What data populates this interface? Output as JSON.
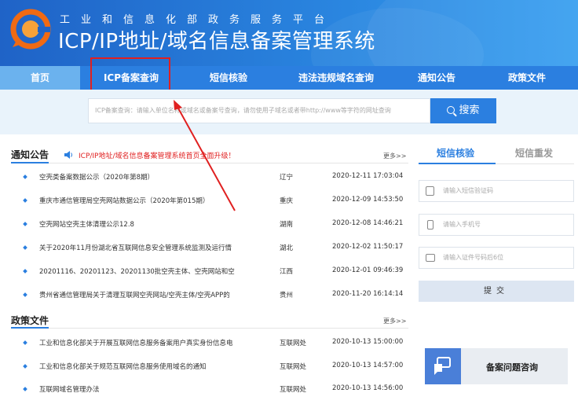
{
  "header": {
    "subtitle": "工业和信息化部政务服务平台",
    "title": "ICP/IP地址/域名信息备案管理系统"
  },
  "nav": {
    "items": [
      "首页",
      "ICP备案查询",
      "短信核验",
      "违法违规域名查询",
      "通知公告",
      "政策文件"
    ],
    "active": "首页",
    "highlighted": "ICP备案查询"
  },
  "search": {
    "placeholder": "ICP备案查询：请输入单位名称或域名或备案号查询，请勿使用子域名或者带http://www等字符的网址查询",
    "button_label": "搜索"
  },
  "notices": {
    "heading": "通知公告",
    "marquee": "ICP/IP地址/域名信息备案管理系统首页全面升级！",
    "more": "更多>>",
    "rows": [
      {
        "title": "空壳类备案数据公示（2020年第8期）",
        "region": "辽宁",
        "date": "2020-12-11 17:03:04"
      },
      {
        "title": "重庆市通信管理局空壳网站数据公示（2020年第015期）",
        "region": "重庆",
        "date": "2020-12-09 14:53:50"
      },
      {
        "title": "空壳网站空壳主体清理公示12.8",
        "region": "湖南",
        "date": "2020-12-08 14:46:21"
      },
      {
        "title": "关于2020年11月份湖北省互联网信息安全管理系统监测及运行情",
        "region": "湖北",
        "date": "2020-12-02 11:50:17"
      },
      {
        "title": "20201116、20201123、20201130批空壳主体、空壳网站和空",
        "region": "江西",
        "date": "2020-12-01 09:46:39"
      },
      {
        "title": "贵州省通信管理局关于清理互联网空壳网站/空壳主体/空壳APP的",
        "region": "贵州",
        "date": "2020-11-20 16:14:14"
      }
    ]
  },
  "policies": {
    "heading": "政策文件",
    "more": "更多>>",
    "rows": [
      {
        "title": "工业和信息化部关于开展互联网信息服务备案用户真实身份信息电",
        "region": "互联网处",
        "date": "2020-10-13 15:00:00"
      },
      {
        "title": "工业和信息化部关于规范互联网信息服务使用域名的通知",
        "region": "互联网处",
        "date": "2020-10-13 14:57:00"
      },
      {
        "title": "互联网域名管理办法",
        "region": "互联网处",
        "date": "2020-10-13 14:56:00"
      }
    ]
  },
  "sms": {
    "tabs": [
      "短信核验",
      "短信重发"
    ],
    "active_tab": "短信核验",
    "code_placeholder": "请输入短信验证码",
    "phone_placeholder": "请输入手机号",
    "id_placeholder": "请输入证件号码后6位",
    "submit_label": "提交"
  },
  "consult": {
    "label": "备案问题咨询"
  },
  "colors": {
    "primary": "#2b7fe0",
    "annotation": "#e02020"
  },
  "icons": [
    "logo-icon",
    "search-icon",
    "speaker-icon",
    "sms-code-icon",
    "phone-icon",
    "id-card-icon",
    "consult-icon",
    "red-arrow-annotation"
  ]
}
